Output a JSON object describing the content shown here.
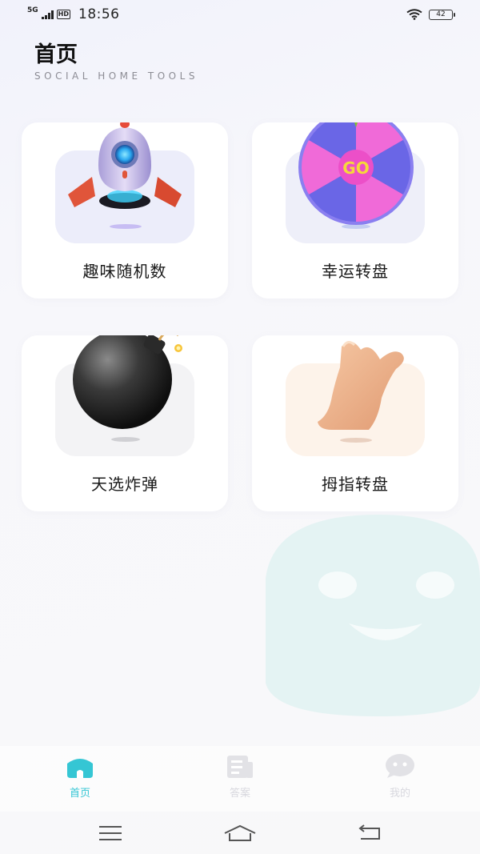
{
  "status_bar": {
    "network": "5G",
    "hd": "HD",
    "time": "18:56",
    "battery": "42"
  },
  "header": {
    "title": "首页",
    "subtitle": "SOCIAL HOME TOOLS"
  },
  "cards": [
    {
      "label": "趣味随机数",
      "icon": "rocket-icon"
    },
    {
      "label": "幸运转盘",
      "icon": "wheel-icon",
      "badge": "GO"
    },
    {
      "label": "天选炸弹",
      "icon": "bomb-icon"
    },
    {
      "label": "拇指转盘",
      "icon": "hand-icon"
    }
  ],
  "tabbar": {
    "tabs": [
      {
        "label": "首页",
        "icon": "home-icon",
        "active": true
      },
      {
        "label": "答案",
        "icon": "news-icon",
        "active": false
      },
      {
        "label": "我的",
        "icon": "chat-bubble-icon",
        "active": false
      }
    ]
  },
  "colors": {
    "accent": "#35c6d4",
    "mascot": "#e4f3f3"
  }
}
